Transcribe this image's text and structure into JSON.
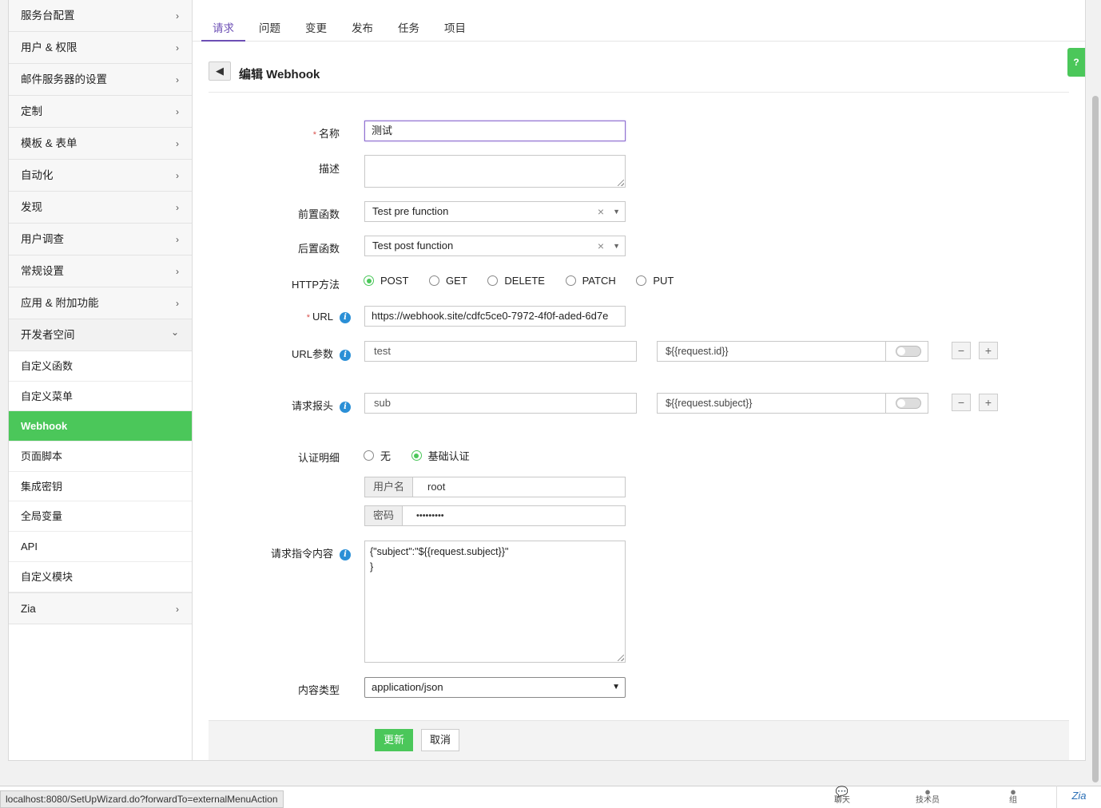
{
  "sidebar": {
    "groups_top": [
      {
        "label": "服务台配置"
      },
      {
        "label": "用户 & 权限"
      },
      {
        "label": "邮件服务器的设置"
      },
      {
        "label": "定制"
      },
      {
        "label": "模板 & 表单"
      },
      {
        "label": "自动化"
      },
      {
        "label": "发现"
      },
      {
        "label": "用户调查"
      },
      {
        "label": "常规设置"
      },
      {
        "label": "应用 & 附加功能"
      }
    ],
    "open_group": {
      "label": "开发者空间"
    },
    "sub_items": [
      {
        "label": "自定义函数"
      },
      {
        "label": "自定义菜单"
      },
      {
        "label": "Webhook"
      },
      {
        "label": "页面脚本"
      },
      {
        "label": "集成密钥"
      },
      {
        "label": "全局变量"
      },
      {
        "label": "API"
      },
      {
        "label": "自定义模块"
      }
    ],
    "last_group": {
      "label": "Zia"
    },
    "chevron_right": "›",
    "chevron_down": "⌄"
  },
  "tabs": [
    {
      "label": "请求"
    },
    {
      "label": "问题"
    },
    {
      "label": "变更"
    },
    {
      "label": "发布"
    },
    {
      "label": "任务"
    },
    {
      "label": "项目"
    }
  ],
  "header": {
    "back_icon": "arrow-left-icon",
    "title": "编辑 Webhook",
    "help": "?"
  },
  "form": {
    "required_mark": "*",
    "name": {
      "label": "名称",
      "value": "测试"
    },
    "description": {
      "label": "描述",
      "value": ""
    },
    "pre_function": {
      "label": "前置函数",
      "value": "Test pre function"
    },
    "post_function": {
      "label": "后置函数",
      "value": "Test post function"
    },
    "http_method": {
      "label": "HTTP方法",
      "options": [
        "POST",
        "GET",
        "DELETE",
        "PATCH",
        "PUT"
      ],
      "selected": "POST"
    },
    "url": {
      "label": "URL",
      "value": "https://webhook.site/cdfc5ce0-7972-4f0f-aded-6d7e"
    },
    "url_params": {
      "label": "URL参数",
      "key": "test",
      "value": "${{request.id}}"
    },
    "headers": {
      "label": "请求报头",
      "key": "sub",
      "value": "${{request.subject}}"
    },
    "auth": {
      "label": "认证明细",
      "options": [
        "无",
        "基础认证"
      ],
      "selected": "基础认证",
      "username_label": "用户名",
      "username": "root",
      "password_label": "密码",
      "password": "•••••••••"
    },
    "payload": {
      "label": "请求指令内容",
      "value": "{\"subject\":\"${{request.subject}}\"\n}"
    },
    "content_type": {
      "label": "内容类型",
      "value": "application/json"
    }
  },
  "buttons": {
    "update": "更新",
    "cancel": "取消",
    "minus": "−",
    "plus": "+"
  },
  "statusbar": {
    "url": "localhost:8080/SetUpWizard.do?forwardTo=externalMenuAction"
  },
  "bottom": {
    "chat": "聊天",
    "technician": "技术员",
    "group": "组",
    "zia": "Zia"
  },
  "colors": {
    "accent_green": "#4bc75a",
    "tab_active": "#6c4fb5",
    "info_blue": "#2a8fd6"
  }
}
